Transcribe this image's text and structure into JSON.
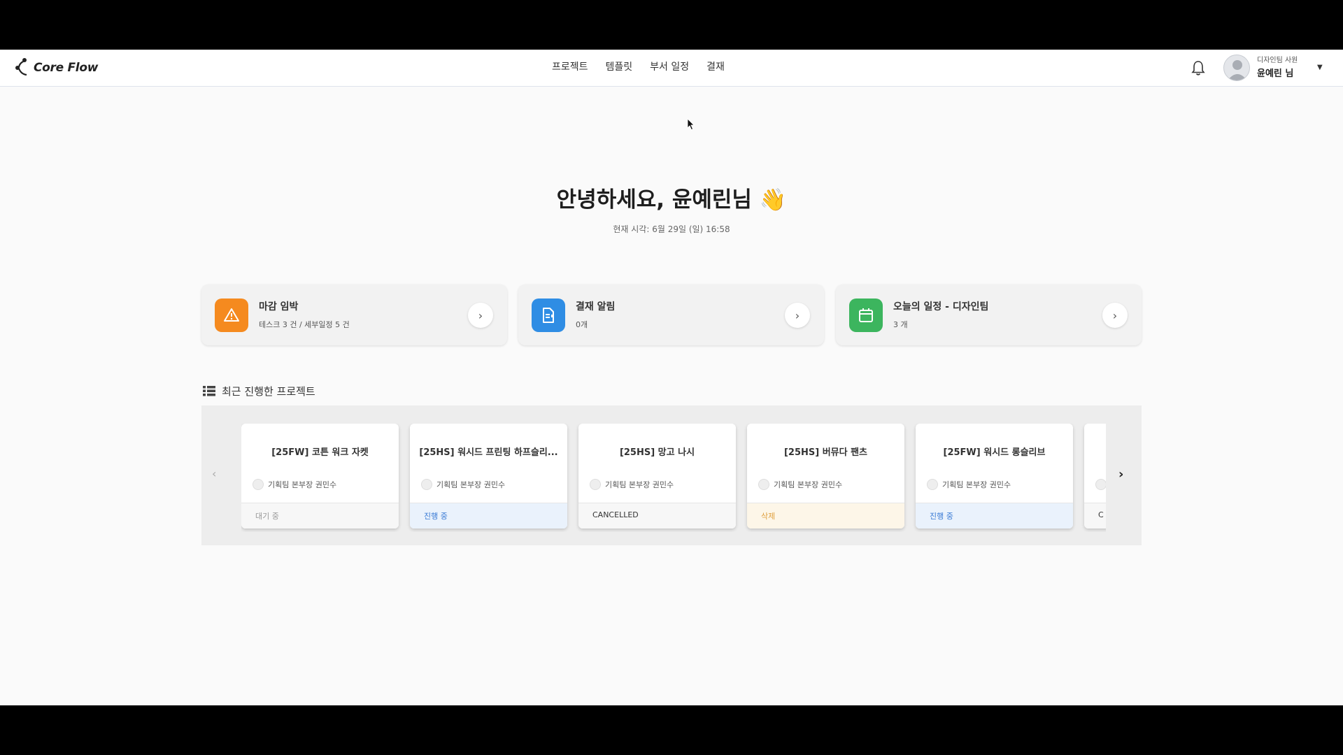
{
  "header": {
    "logo_text": "Core Flow",
    "nav": [
      "프로젝트",
      "템플릿",
      "부서 일정",
      "결재"
    ],
    "user_role": "디자인팀 사원",
    "user_name": "윤예린 님"
  },
  "greeting": "안녕하세요, 윤예린님 👋",
  "current_time": "현재 시각: 6월 29일 (일) 16:58",
  "summary_cards": [
    {
      "title": "마감 임박",
      "subtitle": "테스크 3 건 / 세부일정 5 건",
      "color": "#f58a1f",
      "icon": "warning-icon"
    },
    {
      "title": "결재 알림",
      "subtitle": "0개",
      "color": "#2f8de4",
      "icon": "document-icon"
    },
    {
      "title": "오늘의 일정 - 디자인팀",
      "subtitle": "3 개",
      "color": "#3cb55e",
      "icon": "calendar-icon"
    }
  ],
  "recent": {
    "title": "최근 진행한 프로젝트",
    "projects": [
      {
        "title": "[25FW] 코튼 워크 자켓",
        "owner": "기획팀 본부장 권민수",
        "status": "대기 중",
        "status_color": "#999999",
        "status_bg": "#f7f7f7"
      },
      {
        "title": "[25HS] 워시드 프린팅 하프슬리...",
        "owner": "기획팀 본부장 권민수",
        "status": "진행 중",
        "status_color": "#3a7bd5",
        "status_bg": "#eaf2fc"
      },
      {
        "title": "[25HS] 망고 나시",
        "owner": "기획팀 본부장 권민수",
        "status": "CANCELLED",
        "status_color": "#333333",
        "status_bg": "#f7f7f7"
      },
      {
        "title": "[25HS] 버뮤다 팬츠",
        "owner": "기획팀 본부장 권민수",
        "status": "삭제",
        "status_color": "#e0a040",
        "status_bg": "#fdf6e8"
      },
      {
        "title": "[25FW] 워시드 롱슬리브",
        "owner": "기획팀 본부장 권민수",
        "status": "진행 중",
        "status_color": "#3a7bd5",
        "status_bg": "#eaf2fc"
      },
      {
        "title": "",
        "owner": "",
        "status": "C",
        "status_color": "#333333",
        "status_bg": "#f7f7f7"
      }
    ]
  }
}
